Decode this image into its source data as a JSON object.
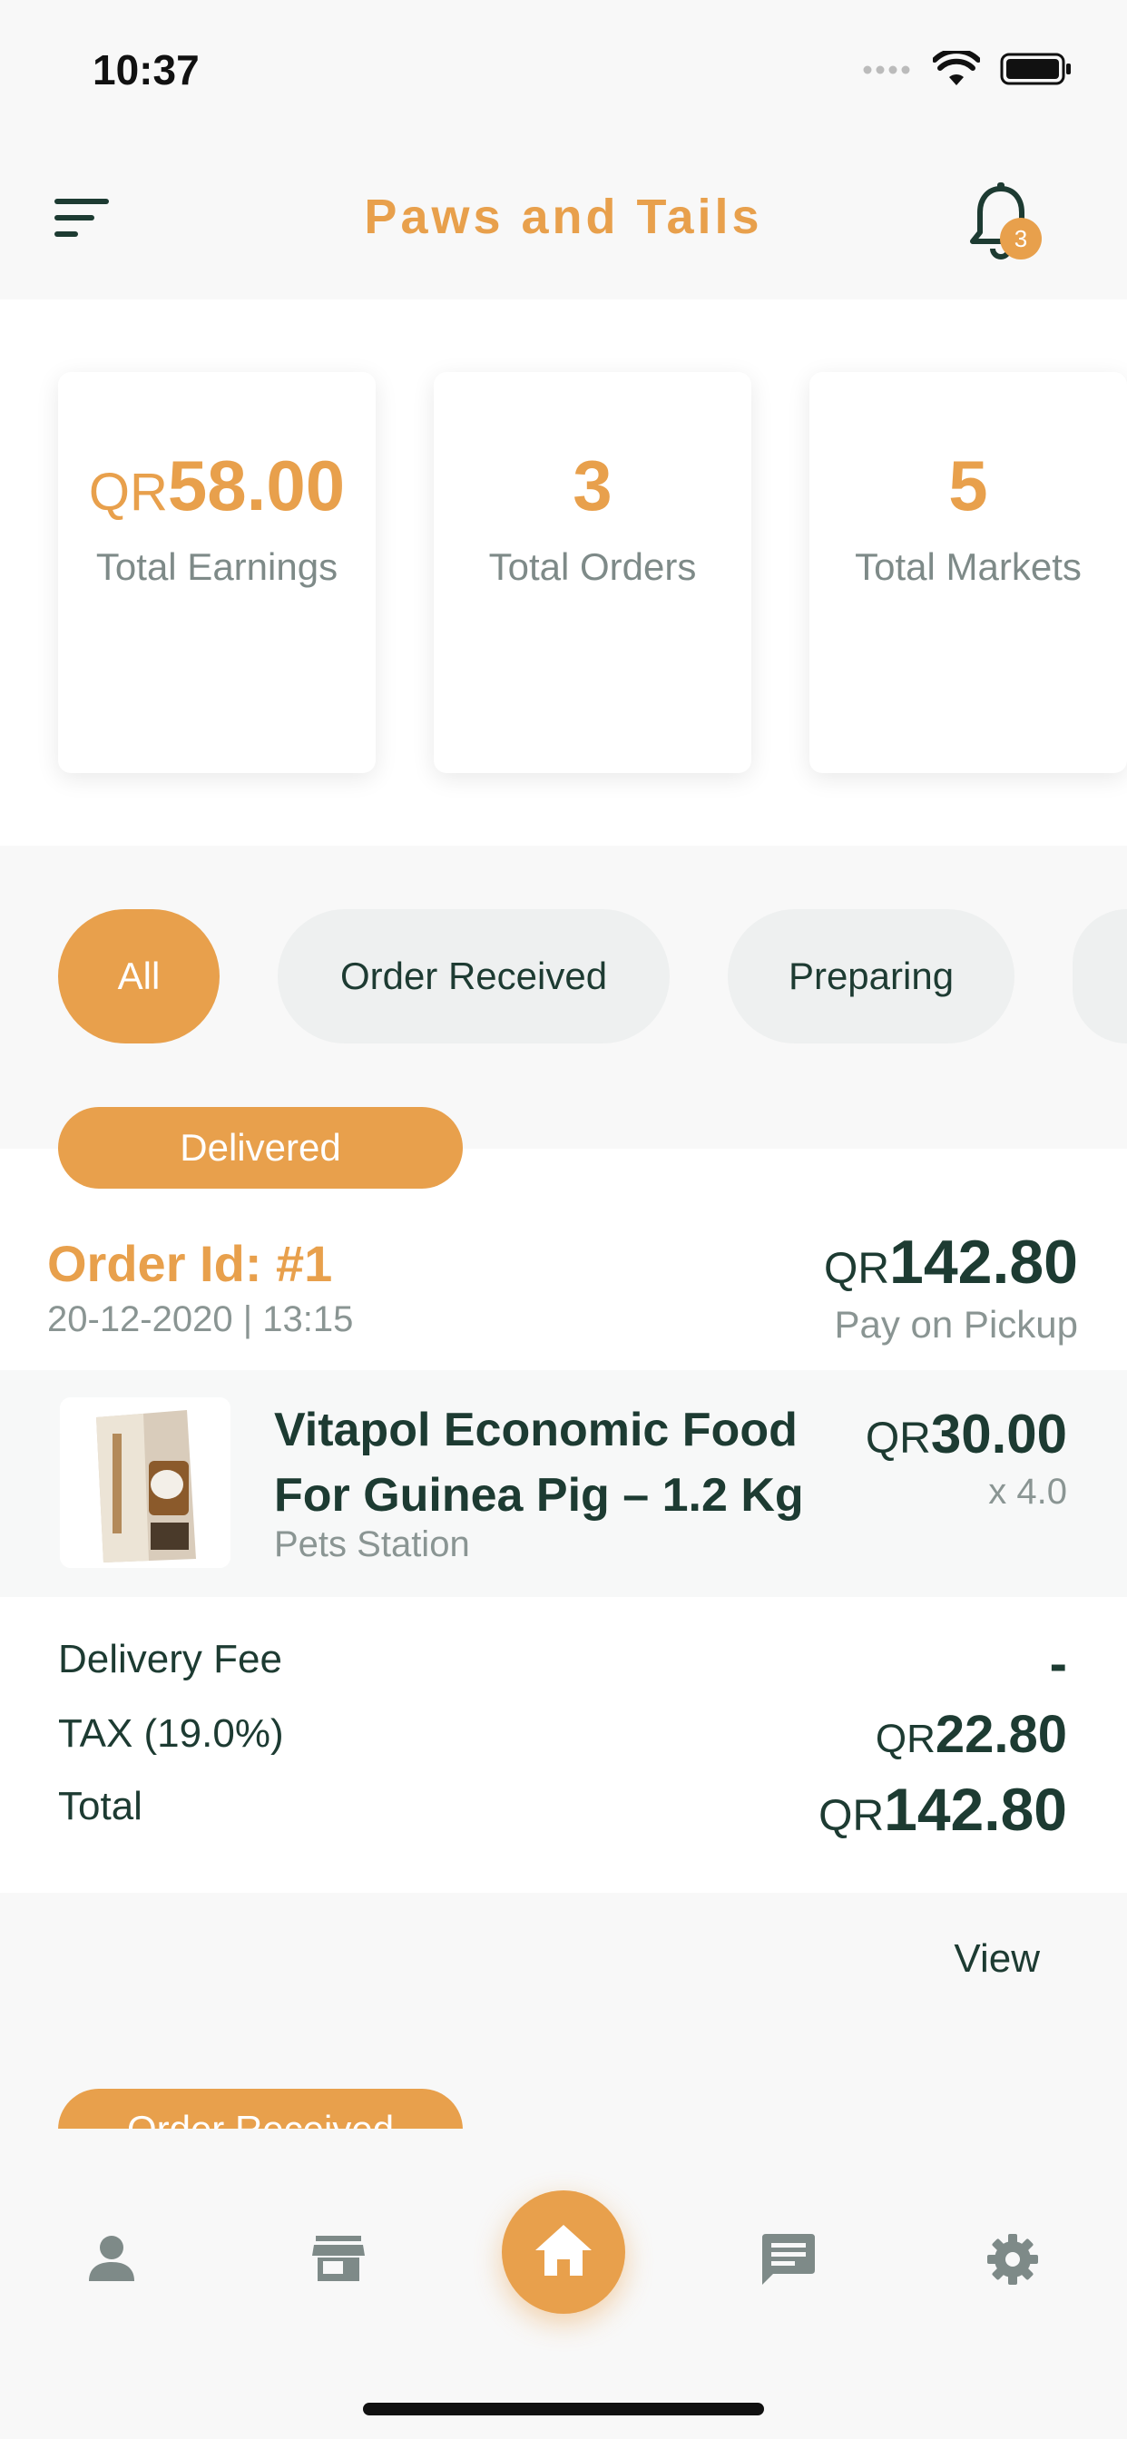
{
  "status_bar": {
    "time": "10:37"
  },
  "header": {
    "title": "Paws and Tails",
    "notification_count": "3",
    "menu_icon": "menu-icon",
    "bell_icon": "bell-icon"
  },
  "stats": [
    {
      "currency": "QR",
      "value": "58.00",
      "label": "Total Earnings"
    },
    {
      "value": "3",
      "label": "Total Orders"
    },
    {
      "value": "5",
      "label": "Total Markets"
    }
  ],
  "filters": [
    {
      "label": "All",
      "active": true
    },
    {
      "label": "Order Received",
      "active": false
    },
    {
      "label": "Preparing",
      "active": false
    }
  ],
  "order": {
    "status": "Delivered",
    "id": "Order Id: #1",
    "date": "20-12-2020 | 13:15",
    "currency": "QR",
    "total": "142.80",
    "payment": "Pay on Pickup",
    "item": {
      "name": "Vitapol Economic Food For Guinea Pig – 1.2 Kg",
      "market": "Pets Station",
      "currency": "QR",
      "price": "30.00",
      "quantity": "x 4.0"
    },
    "summary": {
      "delivery_fee_label": "Delivery Fee",
      "delivery_fee_value": "-",
      "tax_label": "TAX (19.0%)",
      "tax_currency": "QR",
      "tax_value": "22.80",
      "total_label": "Total",
      "total_currency": "QR",
      "total_value": "142.80"
    },
    "view_label": "View"
  },
  "next_order": {
    "status": "Order Received"
  },
  "bottom_nav": [
    "profile-icon",
    "store-icon",
    "home-icon",
    "chat-icon",
    "settings-icon"
  ],
  "colors": {
    "accent": "#e8a04c",
    "text_dark": "#1d3b32",
    "text_muted": "#8a9593"
  }
}
